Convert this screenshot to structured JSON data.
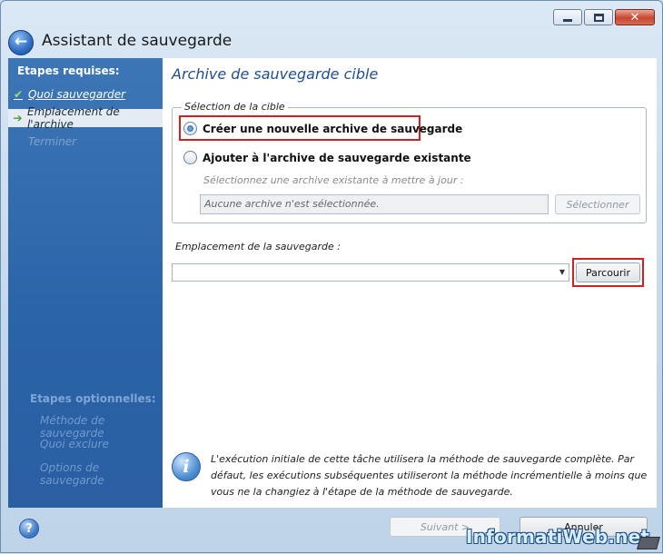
{
  "window": {
    "title": "Assistant de sauvegarde",
    "caption_buttons": {
      "minimize_icon": "minimize-icon",
      "maximize_icon": "maximize-icon",
      "close_icon": "close-icon",
      "close_glyph": "✕"
    }
  },
  "sidebar": {
    "required_heading": "Etapes requises:",
    "items": [
      {
        "label": "Quoi sauvegarder",
        "state": "done",
        "icon": "checkmark-icon",
        "glyph": "✔"
      },
      {
        "label": "Emplacement de l'archive",
        "state": "current",
        "icon": "arrow-right-icon",
        "glyph": "➔"
      },
      {
        "label": "Terminer",
        "state": "disabled",
        "icon": "",
        "glyph": ""
      }
    ],
    "optional_heading": "Etapes optionnelles:",
    "optional_items": [
      {
        "label": "Méthode de sauvegarde"
      },
      {
        "label": "Quoi exclure"
      },
      {
        "label": "Options de sauvegarde"
      }
    ]
  },
  "main": {
    "title": "Archive de sauvegarde cible",
    "target_group": {
      "legend": "Sélection de la cible",
      "option_new": "Créer une nouvelle archive de sauvegarde",
      "option_new_selected": true,
      "option_existing": "Ajouter à l'archive de sauvegarde existante",
      "option_existing_selected": false,
      "select_hint": "Sélectionnez une archive existante à mettre à jour :",
      "archive_field_value": "Aucune archive n'est sélectionnée.",
      "select_button": "Sélectionner"
    },
    "location": {
      "label": "Emplacement de la sauvegarde :",
      "value": "",
      "browse_button": "Parcourir"
    },
    "info": {
      "icon": "info-icon",
      "text": "L'exécution initiale de cette tâche utilisera la méthode de sauvegarde complète. Par défaut, les exécutions subséquentes utiliseront la méthode incrémentielle à moins que vous ne la changiez à l'étape de la méthode de sauvegarde."
    }
  },
  "footer": {
    "help_icon": "help-icon",
    "help_glyph": "?",
    "next_button": "Suivant >",
    "cancel_button": "Annuler"
  },
  "watermark": {
    "text": "InformatiWeb.net"
  },
  "colors": {
    "highlight": "#d02020",
    "sidebar": "#2b63a8",
    "title_blue": "#1f4f93"
  }
}
